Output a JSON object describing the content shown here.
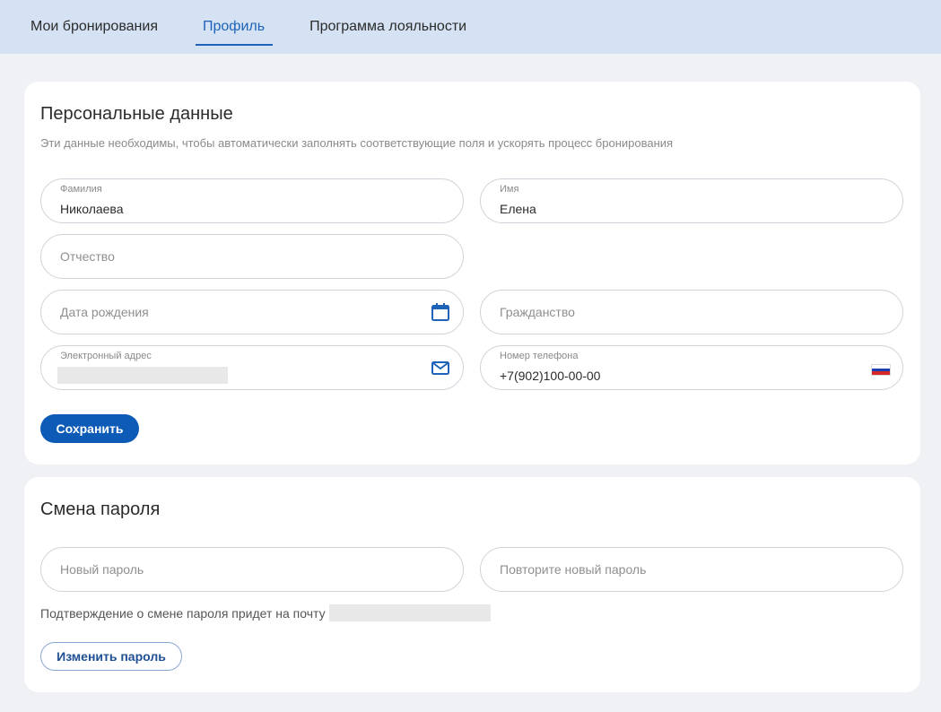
{
  "nav": {
    "tabs": [
      {
        "label": "Мои бронирования",
        "active": false
      },
      {
        "label": "Профиль",
        "active": true
      },
      {
        "label": "Программа лояльности",
        "active": false
      }
    ]
  },
  "personal": {
    "title": "Персональные данные",
    "subtitle": "Эти данные необходимы, чтобы автоматически заполнять соответствующие поля и ускорять процесс бронирования",
    "last_name": {
      "label": "Фамилия",
      "value": "Николаева"
    },
    "first_name": {
      "label": "Имя",
      "value": "Елена"
    },
    "middle_name": {
      "placeholder": "Отчество"
    },
    "birth_date": {
      "placeholder": "Дата рождения",
      "icon": "calendar-icon"
    },
    "citizenship": {
      "placeholder": "Гражданство"
    },
    "email": {
      "label": "Электронный адрес",
      "icon": "mail-icon"
    },
    "phone": {
      "label": "Номер телефона",
      "value": "+7(902)100-00-00",
      "icon": "russia-flag-icon"
    },
    "save_label": "Сохранить"
  },
  "password": {
    "title": "Смена пароля",
    "new_password_placeholder": "Новый пароль",
    "repeat_password_placeholder": "Повторите новый пароль",
    "note": "Подтверждение о смене пароля придет на почту",
    "change_label": "Изменить пароль"
  },
  "colors": {
    "accent": "#0d5bb7",
    "nav_bg": "#d4e2f3",
    "page_bg": "#eff1f5"
  }
}
